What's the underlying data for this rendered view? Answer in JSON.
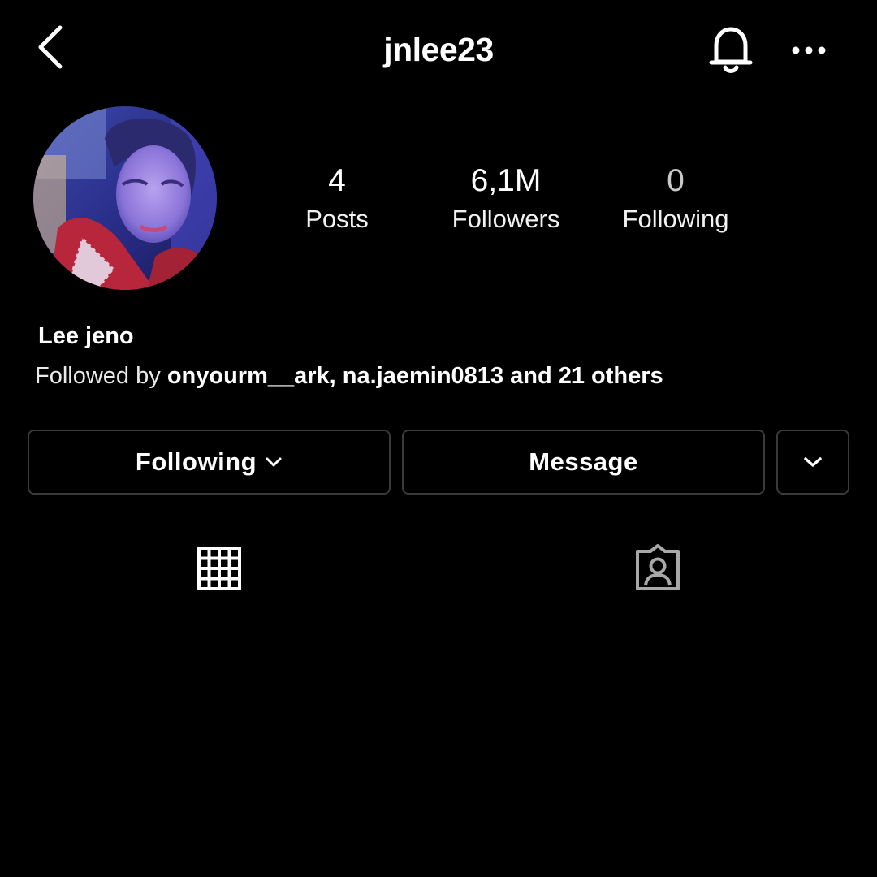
{
  "header": {
    "username": "jnlee23",
    "icons": [
      "chevron-left-icon",
      "bell-icon",
      "more-horizontal-icon"
    ]
  },
  "profile": {
    "avatar": "profile-photo",
    "stats": {
      "posts": {
        "value": "4",
        "label": "Posts"
      },
      "followers": {
        "value": "6,1M",
        "label": "Followers"
      },
      "following": {
        "value": "0",
        "label": "Following"
      }
    },
    "display_name": "Lee jeno",
    "followed_by": {
      "prefix": "Followed by",
      "names": "onyourm__ark, na.jaemin0813 and 21 others"
    }
  },
  "actions": {
    "following_label": "Following",
    "message_label": "Message"
  },
  "tabs": [
    "grid-icon",
    "tagged-icon"
  ],
  "colors": {
    "background": "#000000",
    "text": "#ffffff",
    "border": "#3a3a3a",
    "muted": "#c7c7c7"
  }
}
